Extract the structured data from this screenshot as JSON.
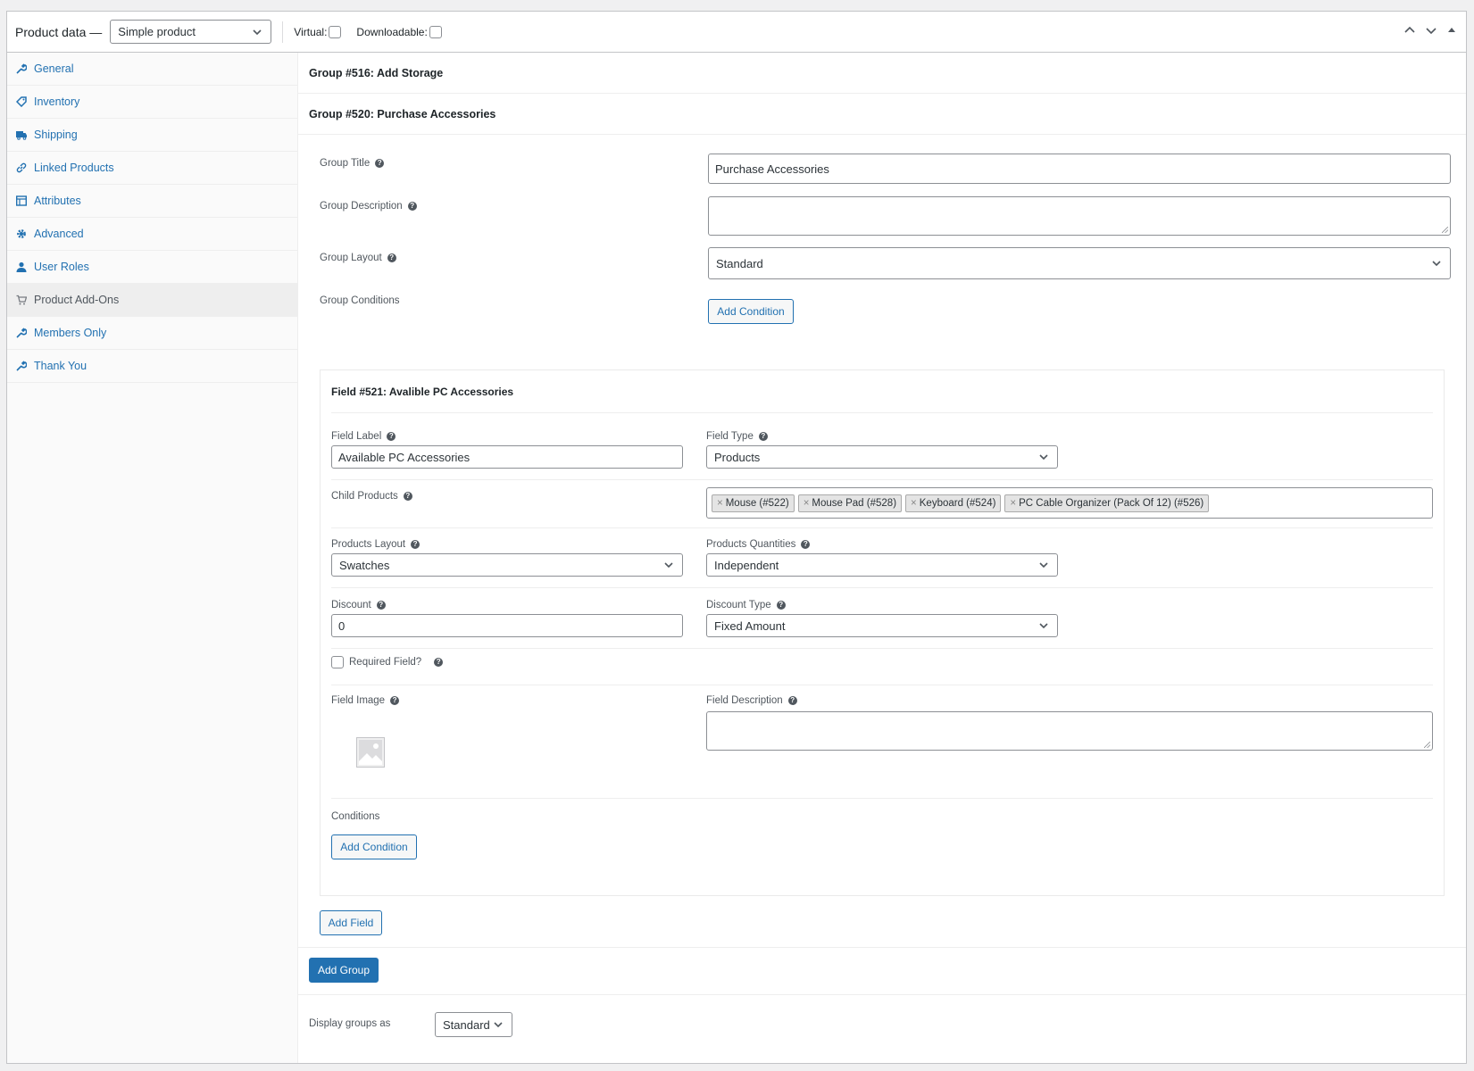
{
  "topbar": {
    "title": "Product data —",
    "product_type": "Simple product",
    "virtual_label": "Virtual:",
    "downloadable_label": "Downloadable:"
  },
  "sidebar": {
    "items": [
      {
        "label": "General",
        "icon": "wrench-icon"
      },
      {
        "label": "Inventory",
        "icon": "tag-icon"
      },
      {
        "label": "Shipping",
        "icon": "truck-icon"
      },
      {
        "label": "Linked Products",
        "icon": "link-icon"
      },
      {
        "label": "Attributes",
        "icon": "table-icon"
      },
      {
        "label": "Advanced",
        "icon": "gear-icon"
      },
      {
        "label": "User Roles",
        "icon": "user-icon"
      },
      {
        "label": "Product Add-Ons",
        "icon": "cart-icon"
      },
      {
        "label": "Members Only",
        "icon": "wrench-icon"
      },
      {
        "label": "Thank You",
        "icon": "wrench-icon"
      }
    ],
    "active_index": 7
  },
  "groups": {
    "group1_title": "Group #516: Add Storage",
    "group2_title": "Group #520: Purchase Accessories"
  },
  "group_form": {
    "title_label": "Group Title",
    "title_value": "Purchase Accessories",
    "description_label": "Group Description",
    "description_value": "",
    "layout_label": "Group Layout",
    "layout_value": "Standard",
    "conditions_label": "Group Conditions",
    "add_condition": "Add Condition"
  },
  "field": {
    "heading": "Field #521: Avalible PC Accessories",
    "label_label": "Field Label",
    "label_value": "Available PC Accessories",
    "type_label": "Field Type",
    "type_value": "Products",
    "child_label": "Child Products",
    "child_products": [
      "Mouse (#522)",
      "Mouse Pad (#528)",
      "Keyboard (#524)",
      "PC Cable Organizer (Pack Of 12) (#526)"
    ],
    "products_layout_label": "Products Layout",
    "products_layout_value": "Swatches",
    "products_quantities_label": "Products Quantities",
    "products_quantities_value": "Independent",
    "discount_label": "Discount",
    "discount_value": "0",
    "discount_type_label": "Discount Type",
    "discount_type_value": "Fixed Amount",
    "required_label": "Required Field?",
    "image_label": "Field Image",
    "description_label": "Field Description",
    "conditions_label": "Conditions",
    "add_condition": "Add Condition"
  },
  "actions": {
    "add_field": "Add Field",
    "add_group": "Add Group",
    "display_label": "Display groups as",
    "display_value": "Standard"
  },
  "colors": {
    "accent": "#2271b1",
    "border": "#c3c4c7",
    "text": "#3c434a"
  }
}
